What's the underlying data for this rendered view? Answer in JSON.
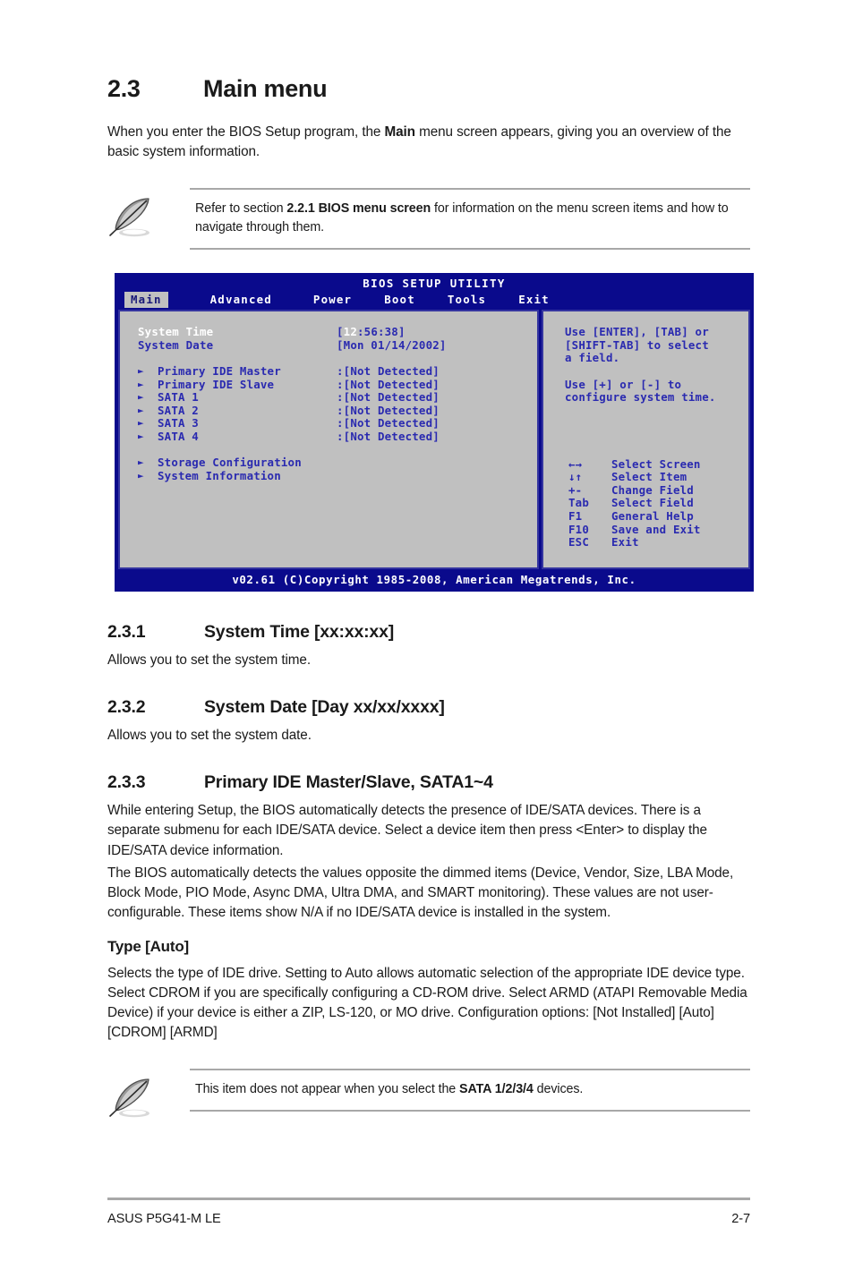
{
  "section": {
    "number": "2.3",
    "title": "Main menu",
    "intro_before_bold": "When you enter the BIOS Setup program, the ",
    "intro_bold": "Main",
    "intro_after_bold": " menu screen appears, giving you an overview of the basic system information."
  },
  "note_top": {
    "icon": "quill-pen-icon",
    "text_before_bold": "Refer to section ",
    "text_bold": "2.2.1 BIOS menu screen",
    "text_after_bold": " for information on the menu screen items and how to navigate through them."
  },
  "bios": {
    "title": "BIOS SETUP UTILITY",
    "tabs": [
      {
        "label": "Main",
        "active": true
      },
      {
        "label": "Advanced",
        "active": false
      },
      {
        "label": "Power",
        "active": false
      },
      {
        "label": "Boot",
        "active": false
      },
      {
        "label": "Tools",
        "active": false
      },
      {
        "label": "Exit",
        "active": false
      }
    ],
    "fields": [
      {
        "label": "System Time",
        "value_cursor": "12",
        "value_rest": ":56:38]",
        "value_open": "[",
        "selected": true
      },
      {
        "label": "System Date",
        "value": "[Mon 01/14/2002]",
        "selected": false
      }
    ],
    "devices": [
      {
        "label": "Primary IDE Master",
        "value": ":[Not Detected]"
      },
      {
        "label": "Primary IDE Slave",
        "value": ":[Not Detected]"
      },
      {
        "label": "SATA 1",
        "value": ":[Not Detected]"
      },
      {
        "label": "SATA 2",
        "value": ":[Not Detected]"
      },
      {
        "label": "SATA 3",
        "value": ":[Not Detected]"
      },
      {
        "label": "SATA 4",
        "value": ":[Not Detected]"
      }
    ],
    "submenus": [
      {
        "label": "Storage Configuration"
      },
      {
        "label": "System Information"
      }
    ],
    "help": [
      "Use [ENTER], [TAB] or",
      "[SHIFT-TAB] to select",
      "a field.",
      "",
      "Use [+] or [-] to",
      "configure system time."
    ],
    "legend": [
      {
        "key": "←→",
        "desc": "Select Screen"
      },
      {
        "key": "↓↑",
        "desc": "Select Item"
      },
      {
        "key": "+-",
        "desc": "Change Field"
      },
      {
        "key": "Tab",
        "desc": "Select Field"
      },
      {
        "key": "F1",
        "desc": "General Help"
      },
      {
        "key": "F10",
        "desc": "Save and Exit"
      },
      {
        "key": "ESC",
        "desc": "Exit"
      }
    ],
    "footer": "v02.61 (C)Copyright 1985-2008, American Megatrends, Inc.",
    "colors": {
      "header_bg": "#0a0a8c",
      "panel_bg": "#c0c0c0",
      "panel_border": "#3434a0",
      "text_blue": "#2a2ab0",
      "text_white": "#ffffff"
    }
  },
  "sub_231": {
    "number": "2.3.1",
    "title": "System Time [xx:xx:xx]",
    "body": "Allows you to set the system time."
  },
  "sub_232": {
    "number": "2.3.2",
    "title": "System Date [Day xx/xx/xxxx]",
    "body": "Allows you to set the system date."
  },
  "sub_233": {
    "number": "2.3.3",
    "title": "Primary IDE Master/Slave, SATA1~4",
    "para1": "While entering Setup, the BIOS automatically detects the presence of IDE/SATA devices. There is a separate submenu for each IDE/SATA device. Select a device item then press <Enter> to display the IDE/SATA device information.",
    "para2": "The BIOS automatically detects the values opposite the dimmed items (Device, Vendor, Size, LBA Mode, Block Mode, PIO Mode, Async DMA, Ultra DMA, and SMART monitoring). These values are not user-configurable. These items show N/A if no IDE/SATA device is installed in the system."
  },
  "type_auto": {
    "heading": "Type [Auto]",
    "body": "Selects the type of IDE drive. Setting to Auto allows automatic selection of the appropriate IDE device type. Select CDROM if you are specifically configuring a CD-ROM drive. Select ARMD (ATAPI Removable Media Device) if your device is either a ZIP, LS-120, or MO drive. Configuration options: [Not Installed] [Auto] [CDROM] [ARMD]"
  },
  "note_bottom": {
    "icon": "quill-pen-icon",
    "text_before_bold": "This item does not appear when you select the ",
    "text_bold": "SATA 1/2/3/4",
    "text_after_bold": " devices."
  },
  "footer": {
    "product": "ASUS P5G41-M LE",
    "page": "2-7"
  }
}
